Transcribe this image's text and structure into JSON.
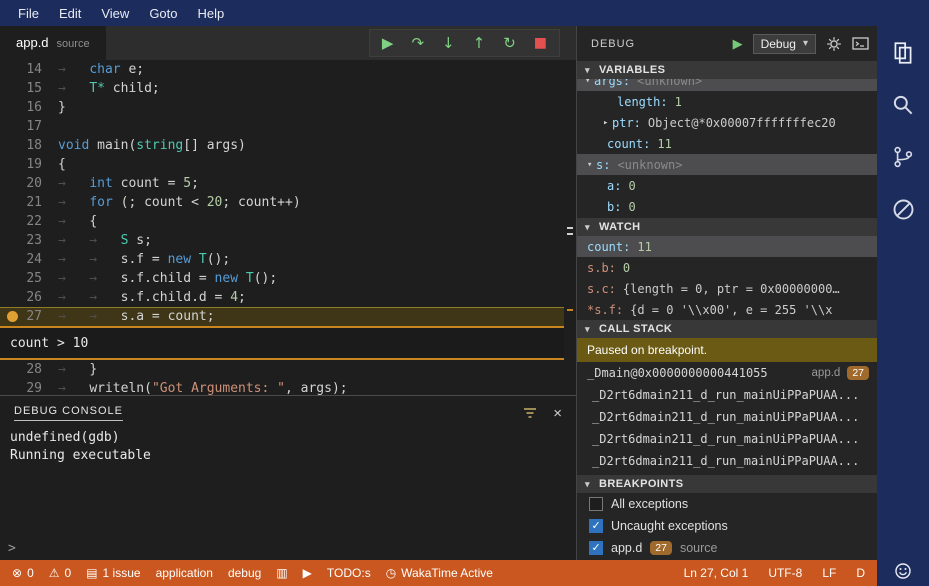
{
  "window": {
    "menu": [
      "File",
      "Edit",
      "View",
      "Goto",
      "Help"
    ]
  },
  "icons": {
    "error": "⊗",
    "warning": "⚠",
    "issues": "▤",
    "doc": "▥",
    "run": "▶",
    "clock": "◷",
    "close": "×",
    "chevron_down": "▾",
    "continue": "▶",
    "step_over": "↷",
    "step_into": "↓",
    "step_out": "↑",
    "restart": "↻",
    "stop": "■",
    "play": "▶"
  },
  "tab": {
    "title": "app.d",
    "type": "source"
  },
  "editor": {
    "breakpoint_line": "27",
    "widget": {
      "text": "count > 10"
    },
    "lines": [
      {
        "num": "14",
        "s": [
          "→   ",
          "char",
          " e;"
        ]
      },
      {
        "num": "15",
        "s": [
          "→   ",
          "T*",
          " child;"
        ]
      },
      {
        "num": "16",
        "s": [
          "}"
        ]
      },
      {
        "num": "17",
        "s": []
      },
      {
        "num": "18",
        "s": [
          "void",
          " main(",
          "string",
          "[] args)"
        ]
      },
      {
        "num": "19",
        "s": [
          "{"
        ]
      },
      {
        "num": "20",
        "s": [
          "→   ",
          "int",
          " count = ",
          "5",
          ";"
        ]
      },
      {
        "num": "21",
        "s": [
          "→   ",
          "for",
          " (; count < ",
          "20",
          "; count++)"
        ]
      },
      {
        "num": "22",
        "s": [
          "→   ",
          "{"
        ]
      },
      {
        "num": "23",
        "s": [
          "→   →   ",
          "S",
          " s;"
        ]
      },
      {
        "num": "24",
        "s": [
          "→   →   ",
          "s.f = ",
          "new",
          " ",
          "T",
          "();"
        ]
      },
      {
        "num": "25",
        "s": [
          "→   →   ",
          "s.f.child = ",
          "new",
          " ",
          "T",
          "();"
        ]
      },
      {
        "num": "26",
        "s": [
          "→   →   ",
          "s.f.child.d = ",
          "4",
          ";"
        ]
      },
      {
        "num": "27",
        "s": [
          "→   →   ",
          "s.a = count;"
        ]
      },
      {
        "num": "28",
        "s": [
          "→   ",
          "}"
        ]
      },
      {
        "num": "29",
        "s": [
          "→   ",
          "writeln(",
          "\"Got Arguments: \"",
          ", args);"
        ]
      }
    ]
  },
  "console": {
    "title": "DEBUG CONSOLE",
    "lines": [
      "undefined(gdb)",
      "Running executable"
    ],
    "prompt": ">"
  },
  "sidebar": {
    "title": "DEBUG",
    "config": "Debug",
    "variables": {
      "title": "VARIABLES",
      "rows": [
        {
          "tw": "▾",
          "name": "args:",
          "value": "<unknown>"
        },
        {
          "name": "length:",
          "value": "1"
        },
        {
          "tw": "▸",
          "name": "ptr:",
          "value": "Object@*0x00007fffffffec20"
        },
        {
          "name": "count:",
          "value": "11"
        },
        {
          "tw": "▾",
          "name": "s:",
          "value": "<unknown>"
        },
        {
          "name": "a:",
          "value": "0"
        },
        {
          "name": "b:",
          "value": "0"
        }
      ]
    },
    "watch": {
      "title": "WATCH",
      "rows": [
        {
          "name": "count:",
          "value": "11"
        },
        {
          "name": "s.b:",
          "value": "0"
        },
        {
          "name": "s.c:",
          "value": "{length = 0, ptr = 0x00000000…"
        },
        {
          "name": "*s.f:",
          "value": "{d = 0 '\\\\x00', e = 255 '\\\\x"
        }
      ]
    },
    "call_stack": {
      "title": "CALL STACK",
      "status": "Paused on breakpoint.",
      "frames": [
        {
          "name": "_Dmain@0x0000000000441055",
          "file": "app.d",
          "line": "27"
        },
        {
          "name": "_D2rt6dmain211_d_run_mainUiPPaPUAA..."
        },
        {
          "name": "_D2rt6dmain211_d_run_mainUiPPaPUAA..."
        },
        {
          "name": "_D2rt6dmain211_d_run_mainUiPPaPUAA..."
        },
        {
          "name": "_D2rt6dmain211_d_run_mainUiPPaPUAA..."
        }
      ]
    },
    "breakpoints": {
      "title": "BREAKPOINTS",
      "rows": [
        {
          "label": "All exceptions",
          "checked": false
        },
        {
          "label": "Uncaught exceptions",
          "checked": true
        },
        {
          "label": "app.d",
          "line": "27",
          "type": "source",
          "checked": true
        }
      ]
    }
  },
  "status_bar": {
    "errors": "0",
    "warnings": "0",
    "issues": "1 issue",
    "config": "application",
    "mode": "debug",
    "todos": "TODO:s",
    "wakatime": "WakaTime Active",
    "cursor": "Ln 27, Col 1",
    "encoding": "UTF-8",
    "eol": "LF",
    "language": "D"
  },
  "colors": {
    "titlebar": "#1c2c5c",
    "statusbar": "#c9571f",
    "breakpoint": "#e0a133",
    "paused_bg": "#6a5a13",
    "badge": "#a16a2d"
  }
}
